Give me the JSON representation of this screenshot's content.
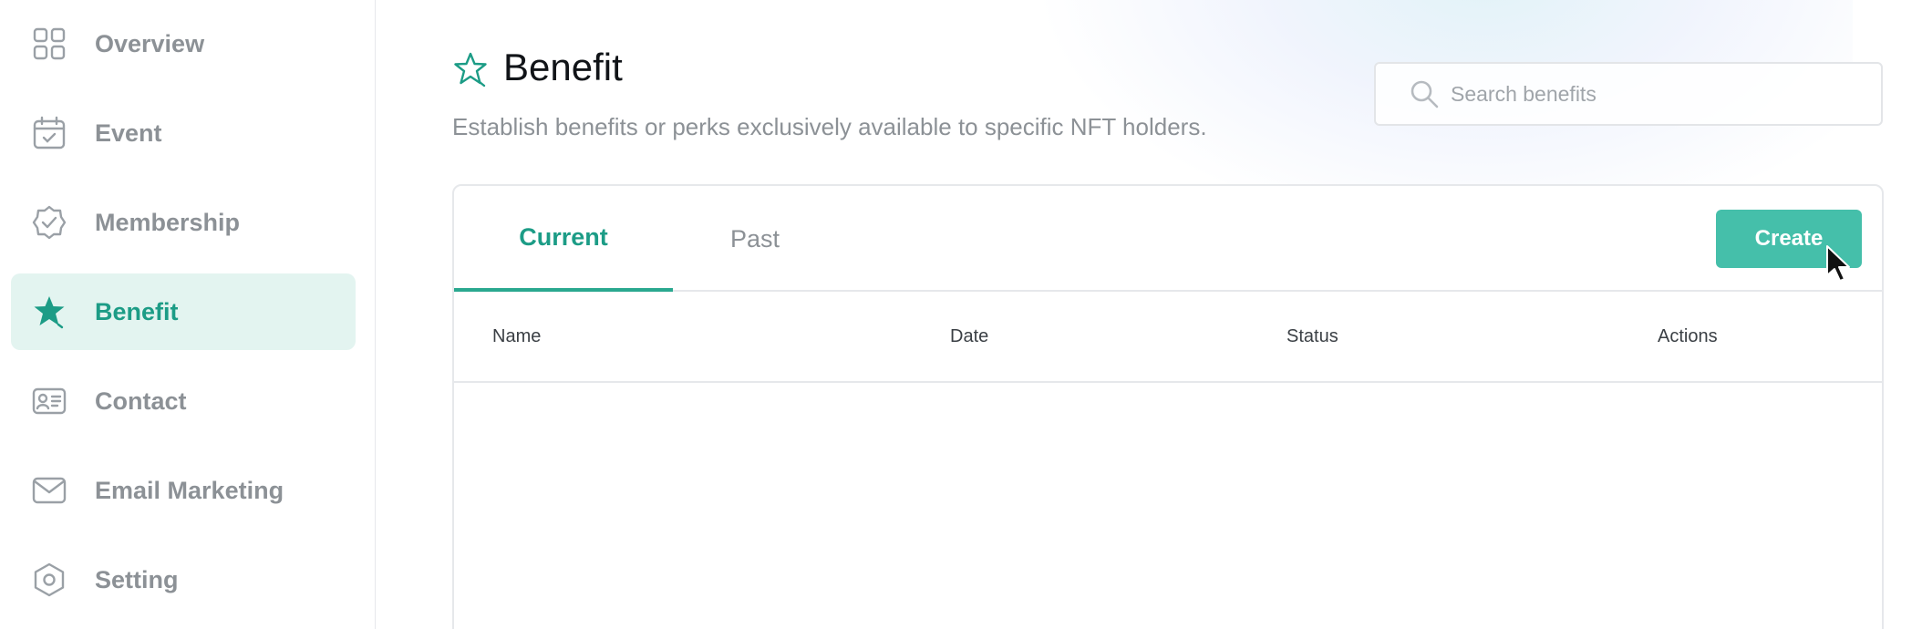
{
  "sidebar": {
    "items": [
      {
        "label": "Overview",
        "icon": "grid-icon"
      },
      {
        "label": "Event",
        "icon": "calendar-check-icon"
      },
      {
        "label": "Membership",
        "icon": "badge-check-icon"
      },
      {
        "label": "Benefit",
        "icon": "star-icon",
        "active": true
      },
      {
        "label": "Contact",
        "icon": "id-card-icon"
      },
      {
        "label": "Email Marketing",
        "icon": "mail-icon"
      },
      {
        "label": "Setting",
        "icon": "hexagon-settings-icon"
      }
    ]
  },
  "header": {
    "title": "Benefit",
    "subtitle": "Establish benefits or perks exclusively available to specific NFT holders.",
    "icon": "star-outline-icon"
  },
  "search": {
    "placeholder": "Search benefits",
    "value": ""
  },
  "tabs": [
    {
      "label": "Current",
      "active": true
    },
    {
      "label": "Past",
      "active": false
    }
  ],
  "toolbar": {
    "create_label": "Create"
  },
  "table": {
    "columns": [
      "Name",
      "Date",
      "Status",
      "Actions"
    ],
    "rows": []
  },
  "colors": {
    "accent": "#1c9c86",
    "button": "#45bfaa",
    "active_bg": "#e3f4f0",
    "muted_text": "#8c9196"
  }
}
